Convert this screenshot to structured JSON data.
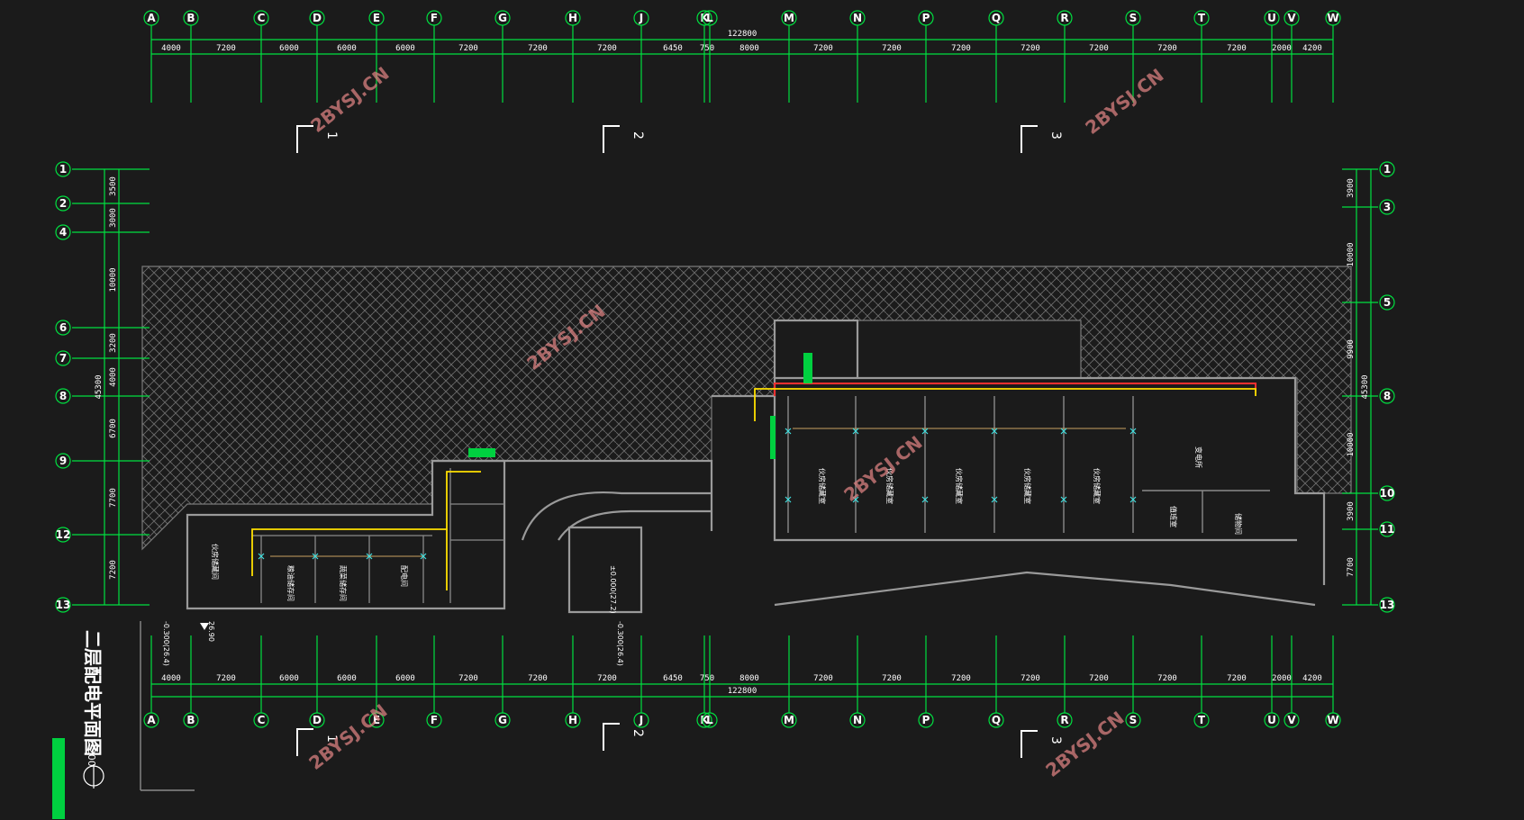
{
  "drawing": {
    "title": "二层配电平面图",
    "scale": "1:200",
    "watermark": "2BYSJ.CN",
    "elevations": {
      "exterior": "-0.300(26.4)",
      "ramp": "±0.000(27.2)",
      "spot": "26.90"
    },
    "column_axes": [
      "A",
      "B",
      "C",
      "D",
      "E",
      "F",
      "G",
      "H",
      "J",
      "K",
      "L",
      "M",
      "N",
      "P",
      "Q",
      "R",
      "S",
      "T",
      "U",
      "V",
      "W"
    ],
    "column_spacings": [
      "4000",
      "7200",
      "6000",
      "6000",
      "6000",
      "7200",
      "7200",
      "7200",
      "6450",
      "750",
      "8000",
      "7200",
      "7200",
      "7200",
      "7200",
      "7200",
      "7200",
      "7200",
      "2000",
      "4200"
    ],
    "total_length": "122800",
    "left_row_axes": [
      "1",
      "2",
      "4",
      "6",
      "7",
      "8",
      "9",
      "12",
      "13"
    ],
    "left_spacings": [
      "3500",
      "3000",
      "10000",
      "3200",
      "4000",
      "6700",
      "7700",
      "7200"
    ],
    "left_total": "45300",
    "right_row_axes": [
      "1",
      "3",
      "5",
      "8",
      "10",
      "11",
      "13"
    ],
    "right_spacings": [
      "3900",
      "10000",
      "9900",
      "10000",
      "3900",
      "7700"
    ],
    "right_total": "45300",
    "sections": [
      "1",
      "2",
      "3"
    ],
    "rooms_left": [
      "伙房储藏间",
      "粮油储存间",
      "蔬菜储存间",
      "配电间"
    ],
    "rooms_right": [
      "伙房储藏室",
      "伙房储藏室",
      "伙房储藏室",
      "伙房储藏室",
      "伙房储藏室",
      "变电所",
      "值班室",
      "储物间"
    ]
  }
}
